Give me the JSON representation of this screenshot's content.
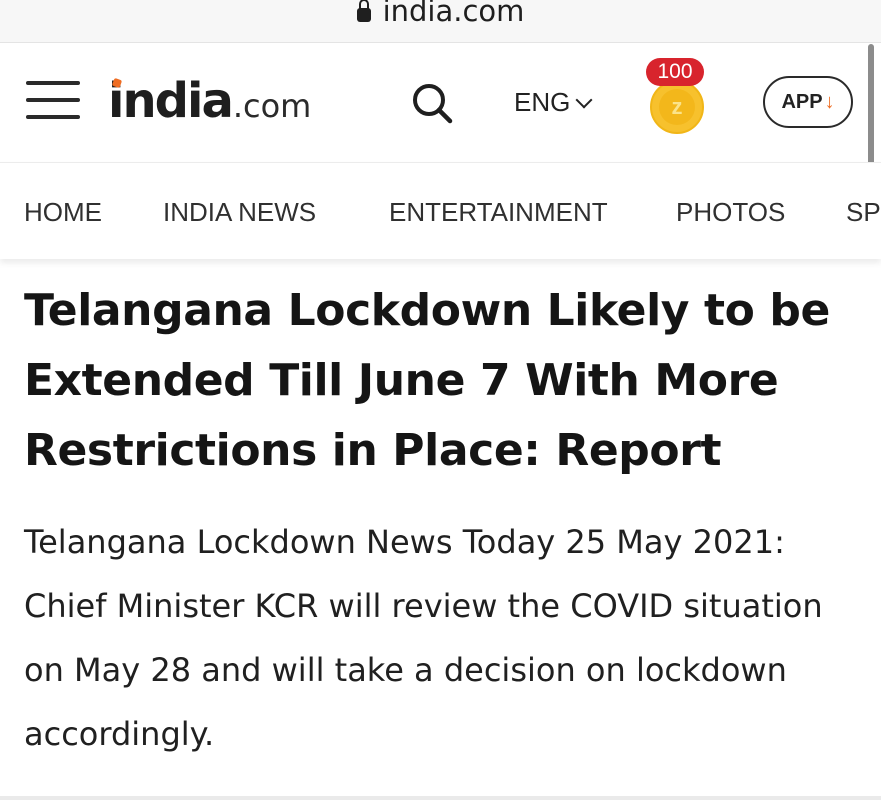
{
  "browser": {
    "url": "india.com",
    "lock_icon": "lock-icon"
  },
  "header": {
    "logo_brand": "india",
    "logo_suffix": ".com",
    "language": "ENG",
    "coins_count": "100",
    "coin_symbol": "z",
    "app_button_label": "APP",
    "app_button_arrow": "↓",
    "accent_color": "#ee6d23",
    "badge_color": "#d8242d"
  },
  "nav": {
    "items": [
      "HOME",
      "INDIA NEWS",
      "ENTERTAINMENT",
      "PHOTOS",
      "SP"
    ]
  },
  "article": {
    "headline": "Telangana Lockdown Likely to be Extended Till June 7 With More Restrictions in Place: Report",
    "summary": "Telangana Lockdown News Today 25 May 2021: Chief Minister KCR will review the COVID situation on May 28 and will take a decision on lockdown accordingly."
  }
}
